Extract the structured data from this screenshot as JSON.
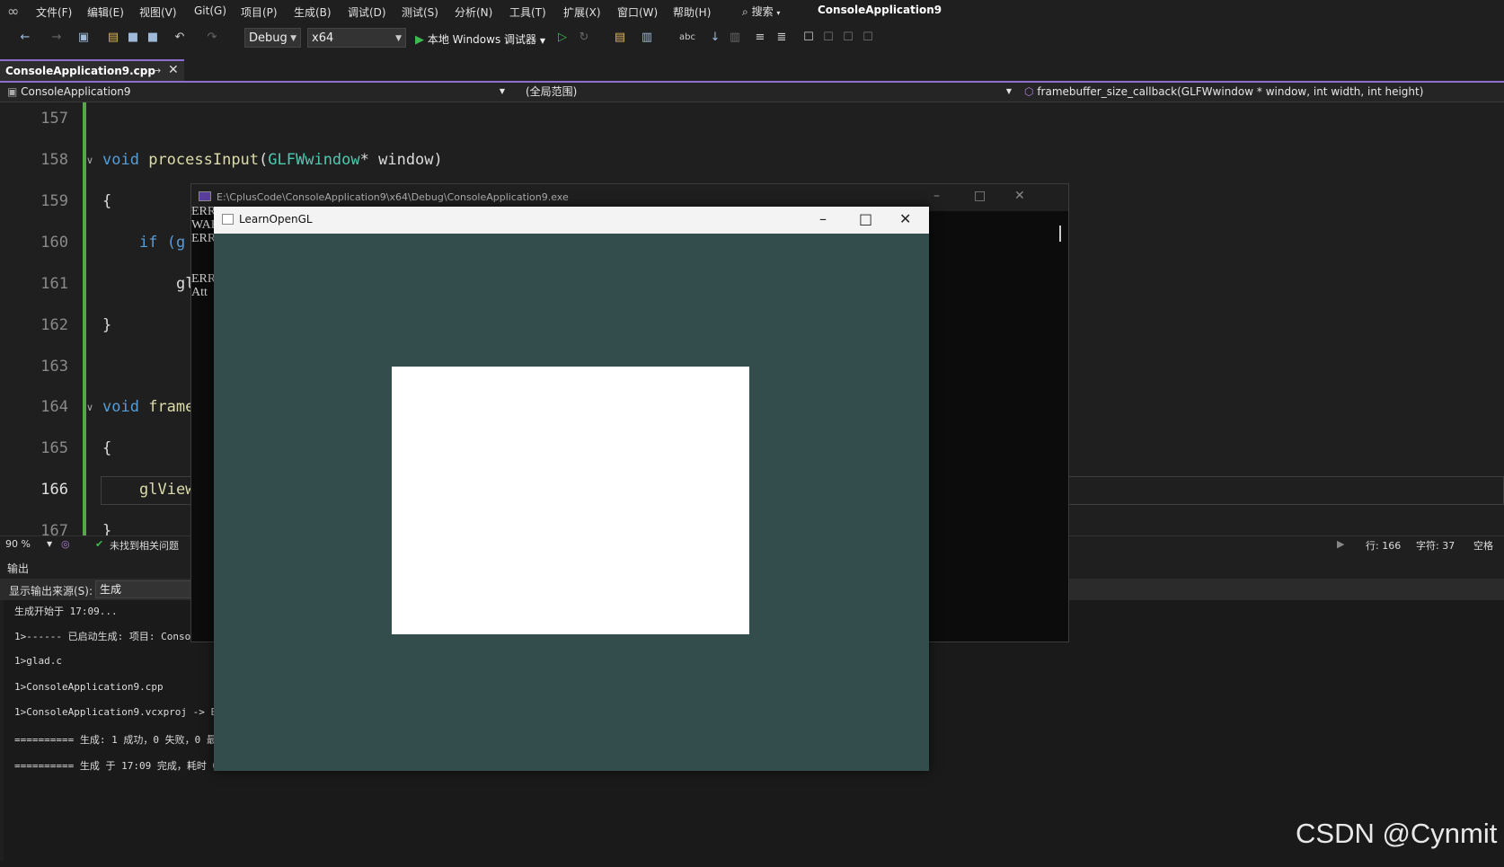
{
  "menubar": {
    "items": [
      "文件(F)",
      "编辑(E)",
      "视图(V)",
      "Git(G)",
      "项目(P)",
      "生成(B)",
      "调试(D)",
      "测试(S)",
      "分析(N)",
      "工具(T)",
      "扩展(X)",
      "窗口(W)",
      "帮助(H)"
    ],
    "search_label": "搜索",
    "app_title": "ConsoleApplication9"
  },
  "toolbar": {
    "config": "Debug",
    "platform": "x64",
    "run_label": "本地 Windows 调试器"
  },
  "tab": {
    "label": "ConsoleApplication9.cpp"
  },
  "navbar": {
    "project": "ConsoleApplication9",
    "scope": "(全局范围)",
    "member": "framebuffer_size_callback(GLFWwindow * window, int width, int height)"
  },
  "editor": {
    "line_numbers": [
      "157",
      "158",
      "159",
      "160",
      "161",
      "162",
      "163",
      "164",
      "165",
      "166",
      "167"
    ],
    "current_line": "166",
    "lines": {
      "l158_kw": "void",
      "l158_fn": "processInput",
      "l158_type": "GLFWwindow",
      "l158_rest": "* window)",
      "l159": "{",
      "l160": "if (g",
      "l161": "gl",
      "l162": "}",
      "l164_kw": "void",
      "l164_fn": "frame",
      "l165": "{",
      "l166": "glView",
      "l167": "}"
    }
  },
  "editor_status": {
    "zoom": "90 %",
    "issues": "未找到相关问题",
    "line": "行: 166",
    "char": "字符: 37",
    "whitespace": "空格"
  },
  "output": {
    "title": "输出",
    "source_label": "显示输出来源(S):",
    "source_value": "生成",
    "lines": [
      "生成开始于 17:09...",
      "1>------ 已启动生成: 项目: Consol",
      "1>glad.c",
      "1>ConsoleApplication9.cpp",
      "1>ConsoleApplication9.vcxproj -> E:\\C",
      "========== 生成: 1 成功，0 失败，0 最",
      "========== 生成 于 17:09 完成，耗时 0"
    ]
  },
  "console": {
    "title": "E:\\CplusCode\\ConsoleApplication9\\x64\\Debug\\ConsoleApplication9.exe",
    "lines": [
      "ERR",
      "WAR",
      "ERR",
      "ERR",
      "Att"
    ]
  },
  "gl_window": {
    "title": "LearnOpenGL",
    "clear_color": "#334d4d",
    "rect_color": "#ffffff"
  },
  "watermark": "CSDN @Cynmit"
}
